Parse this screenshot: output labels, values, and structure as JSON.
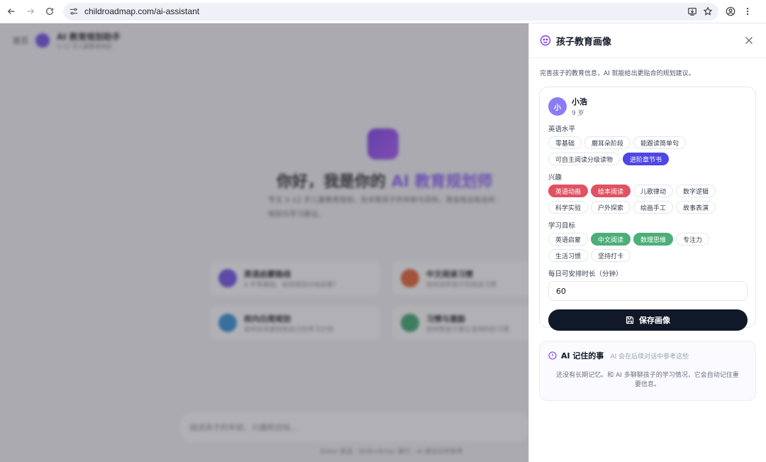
{
  "browser": {
    "url": "childroadmap.com/ai-assistant"
  },
  "background": {
    "back_label": "首页",
    "app_name": "AI 教育规划助手",
    "app_sub": "3–12 岁儿童教育规划",
    "hero_title_a": "你好，我是你的",
    "hero_title_b": "AI 教育规划师",
    "hero_desc": "专注 3–12 岁儿童教育规划，告诉我孩子的年龄与目标，我会给出贴合的规划与学习建议。",
    "cards": [
      {
        "title": "英语启蒙路线",
        "sub": "4 岁零基础，如何规划分级启蒙？",
        "color": "#6d4ee6"
      },
      {
        "title": "中文阅读习惯",
        "sub": "如何培养孩子的阅读习惯",
        "color": "#e4602f"
      },
      {
        "title": "校内白周规划",
        "sub": "如何安排家校和自己的学习计划",
        "color": "#2f8fd6"
      },
      {
        "title": "习惯与激励",
        "sub": "如何帮孩子建立坚持的好习惯",
        "color": "#3aa66b"
      }
    ],
    "input_placeholder": "描述孩子的年龄、兴趣和目标...",
    "footer": "Enter 发送 · Shift+Enter 换行 · AI 建议仅供参考"
  },
  "panel": {
    "title": "孩子教育画像",
    "description": "完善孩子的教育信息，AI 就能给出更贴合的规划建议。",
    "child": {
      "avatar_letter": "小",
      "name": "小浩",
      "age": "9 岁"
    },
    "english_level": {
      "label": "英语水平",
      "options": [
        {
          "text": "零基础",
          "selected": false
        },
        {
          "text": "磨耳朵阶段",
          "selected": false
        },
        {
          "text": "能跟读简单句",
          "selected": false
        },
        {
          "text": "可自主阅读分级读物",
          "selected": false
        },
        {
          "text": "进阶章节书",
          "selected": true,
          "style": "blue"
        }
      ]
    },
    "interests": {
      "label": "兴趣",
      "options": [
        {
          "text": "英语动画",
          "selected": true,
          "style": "red"
        },
        {
          "text": "绘本阅读",
          "selected": true,
          "style": "red"
        },
        {
          "text": "儿歌律动",
          "selected": false
        },
        {
          "text": "数字逻辑",
          "selected": false
        },
        {
          "text": "科学实验",
          "selected": false
        },
        {
          "text": "户外探索",
          "selected": false
        },
        {
          "text": "绘画手工",
          "selected": false
        },
        {
          "text": "故事表演",
          "selected": false
        }
      ]
    },
    "goals": {
      "label": "学习目标",
      "options": [
        {
          "text": "英语启蒙",
          "selected": false
        },
        {
          "text": "中文阅读",
          "selected": true,
          "style": "green"
        },
        {
          "text": "数理思维",
          "selected": true,
          "style": "green"
        },
        {
          "text": "专注力",
          "selected": false
        },
        {
          "text": "生活习惯",
          "selected": false
        },
        {
          "text": "坚持打卡",
          "selected": false
        }
      ]
    },
    "daily_time": {
      "label": "每日可安排时长（分钟）",
      "value": "60"
    },
    "save_label": "保存画像",
    "memory": {
      "title": "AI 记住的事",
      "subtitle": "AI 会在后续对话中参考这些",
      "empty_text": "还没有长期记忆。和 AI 多聊聊孩子的学习情况，它会自动记住重要信息。"
    }
  },
  "colors": {
    "accent": "#7c3aed",
    "chip_blue": "#4f46e5",
    "chip_red": "#e05263",
    "chip_green": "#4cae78",
    "save_button": "#111827"
  }
}
